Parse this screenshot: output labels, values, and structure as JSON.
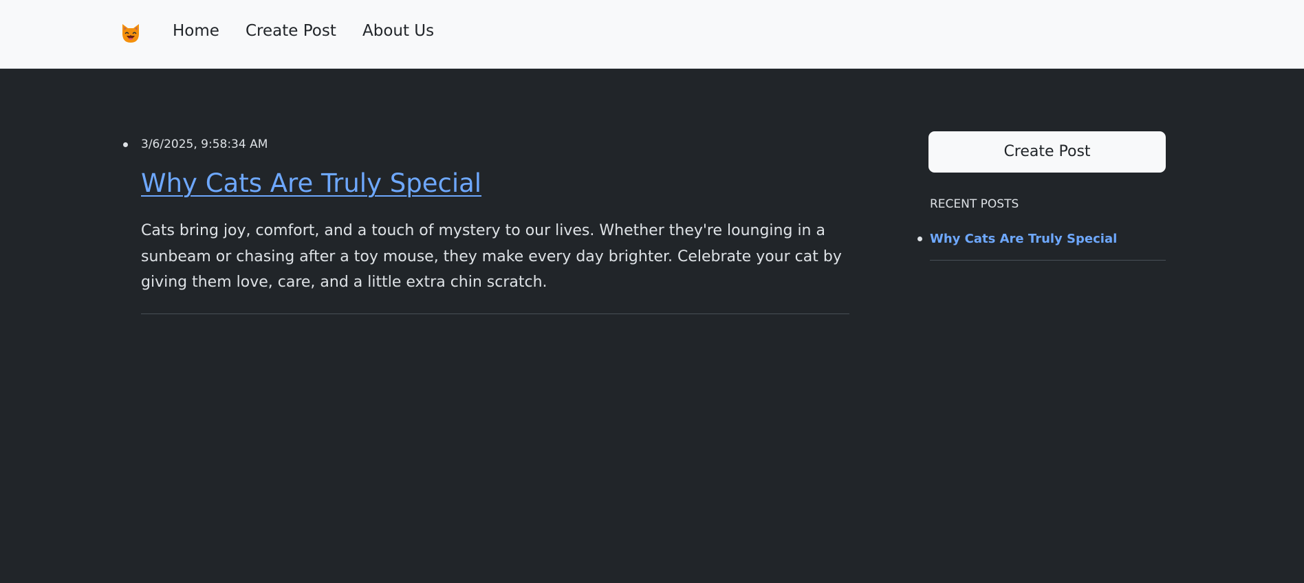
{
  "navbar": {
    "logo_icon": "cat-face-icon",
    "links": [
      "Home",
      "Create Post",
      "About Us"
    ]
  },
  "posts": [
    {
      "date": "3/6/2025, 9:58:34 AM",
      "title": "Why Cats Are Truly Special",
      "body": "Cats bring joy, comfort, and a touch of mystery to our lives. Whether they're lounging in a sunbeam or chasing after a toy mouse, they make every day brighter. Celebrate your cat by giving them love, care, and a little extra chin scratch."
    }
  ],
  "sidebar": {
    "create_button": "Create Post",
    "recent_heading": "RECENT POSTS",
    "recent_posts": [
      "Why Cats Are Truly Special"
    ]
  },
  "colors": {
    "page_background": "#212529",
    "navbar_background": "#f8f9fa",
    "link": "#6ea8fe",
    "text_muted": "#dee2e6"
  }
}
